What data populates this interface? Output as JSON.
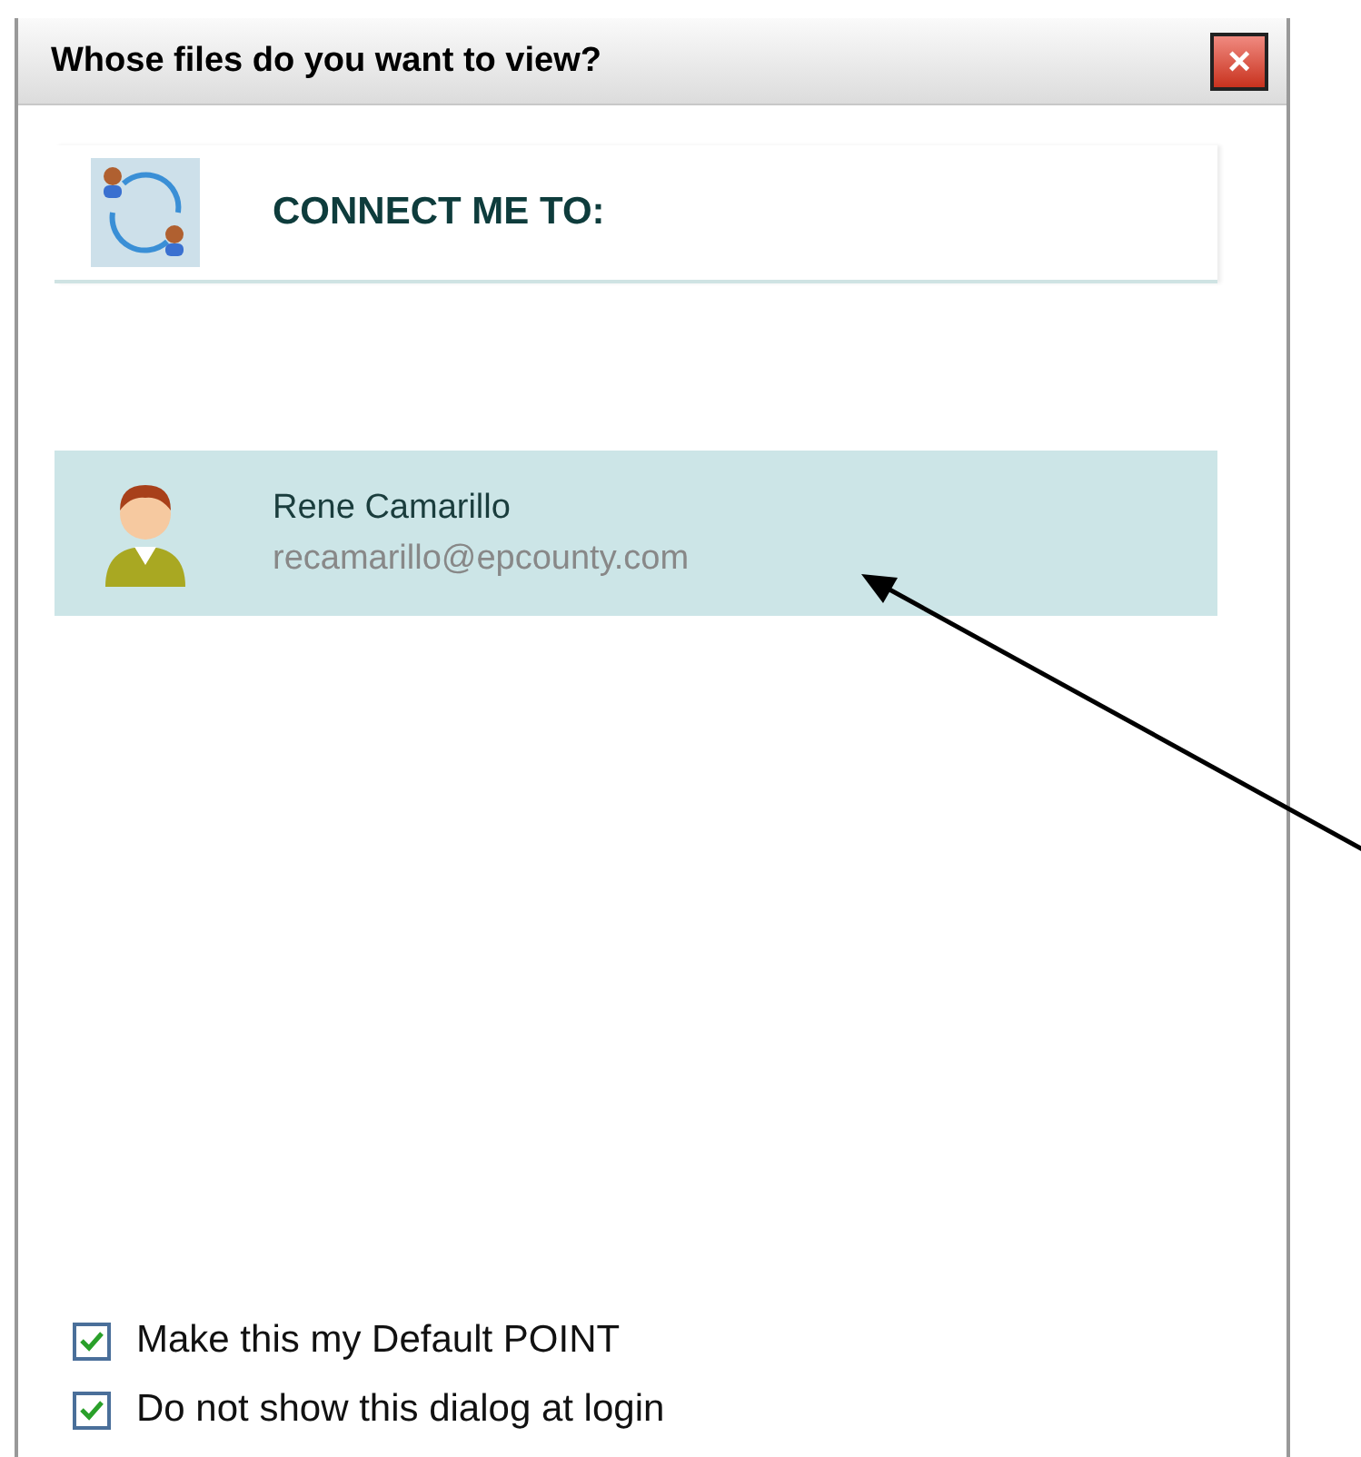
{
  "window": {
    "title": "Whose files do you want to view?",
    "close": "×"
  },
  "header": {
    "title": "CONNECT ME TO:"
  },
  "people": [
    {
      "name": "Rene Camarillo",
      "email": "recamarillo@epcounty.com",
      "selected": true
    }
  ],
  "options": [
    {
      "label": "Make this my Default POINT",
      "checked": true
    },
    {
      "label": "Do not show this dialog at login",
      "checked": true
    }
  ]
}
